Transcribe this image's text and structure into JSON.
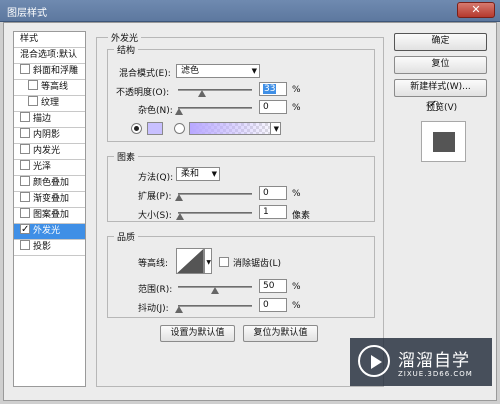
{
  "window": {
    "title": "图层样式",
    "close_label": "✕"
  },
  "left_panel": {
    "header": "样式",
    "blend_options": "混合选项:默认",
    "items": [
      {
        "label": "斜面和浮雕",
        "checked": false,
        "indent": false
      },
      {
        "label": "等高线",
        "checked": false,
        "indent": true
      },
      {
        "label": "纹理",
        "checked": false,
        "indent": true
      },
      {
        "label": "描边",
        "checked": false,
        "indent": false
      },
      {
        "label": "内阴影",
        "checked": false,
        "indent": false
      },
      {
        "label": "内发光",
        "checked": false,
        "indent": false
      },
      {
        "label": "光泽",
        "checked": false,
        "indent": false
      },
      {
        "label": "颜色叠加",
        "checked": false,
        "indent": false
      },
      {
        "label": "渐变叠加",
        "checked": false,
        "indent": false
      },
      {
        "label": "图案叠加",
        "checked": false,
        "indent": false
      },
      {
        "label": "外发光",
        "checked": true,
        "indent": false,
        "selected": true
      },
      {
        "label": "投影",
        "checked": false,
        "indent": false
      }
    ]
  },
  "outer_glow": {
    "title": "外发光",
    "structure": {
      "title": "结构",
      "blend_mode_label": "混合模式(E):",
      "blend_mode_value": "滤色",
      "opacity_label": "不透明度(O):",
      "opacity_value": "33",
      "opacity_unit": "%",
      "opacity_fraction": 0.33,
      "noise_label": "杂色(N):",
      "noise_value": "0",
      "noise_unit": "%",
      "noise_fraction": 0,
      "glow_color": "#c8c0ff"
    },
    "elements": {
      "title": "图素",
      "method_label": "方法(Q):",
      "method_value": "柔和",
      "spread_label": "扩展(P):",
      "spread_value": "0",
      "spread_unit": "%",
      "spread_fraction": 0,
      "size_label": "大小(S):",
      "size_value": "1",
      "size_unit": "像素",
      "size_fraction": 0.01
    },
    "quality": {
      "title": "品质",
      "contour_label": "等高线:",
      "antialias_label": "消除锯齿(L)",
      "range_label": "范围(R):",
      "range_value": "50",
      "range_unit": "%",
      "range_fraction": 0.5,
      "jitter_label": "抖动(J):",
      "jitter_value": "0",
      "jitter_unit": "%",
      "jitter_fraction": 0
    },
    "set_default_label": "设置为默认值",
    "reset_default_label": "复位为默认值"
  },
  "right_panel": {
    "ok_label": "确定",
    "reset_label": "复位",
    "new_style_label": "新建样式(W)...",
    "preview_label": "预览(V)",
    "preview_checked": true
  },
  "watermark": {
    "brand": "溜溜自学",
    "url": "ZIXUE.3D66.COM"
  },
  "colors": {
    "accent": "#3f8fe6",
    "title_bar": "#6f8ab0"
  }
}
